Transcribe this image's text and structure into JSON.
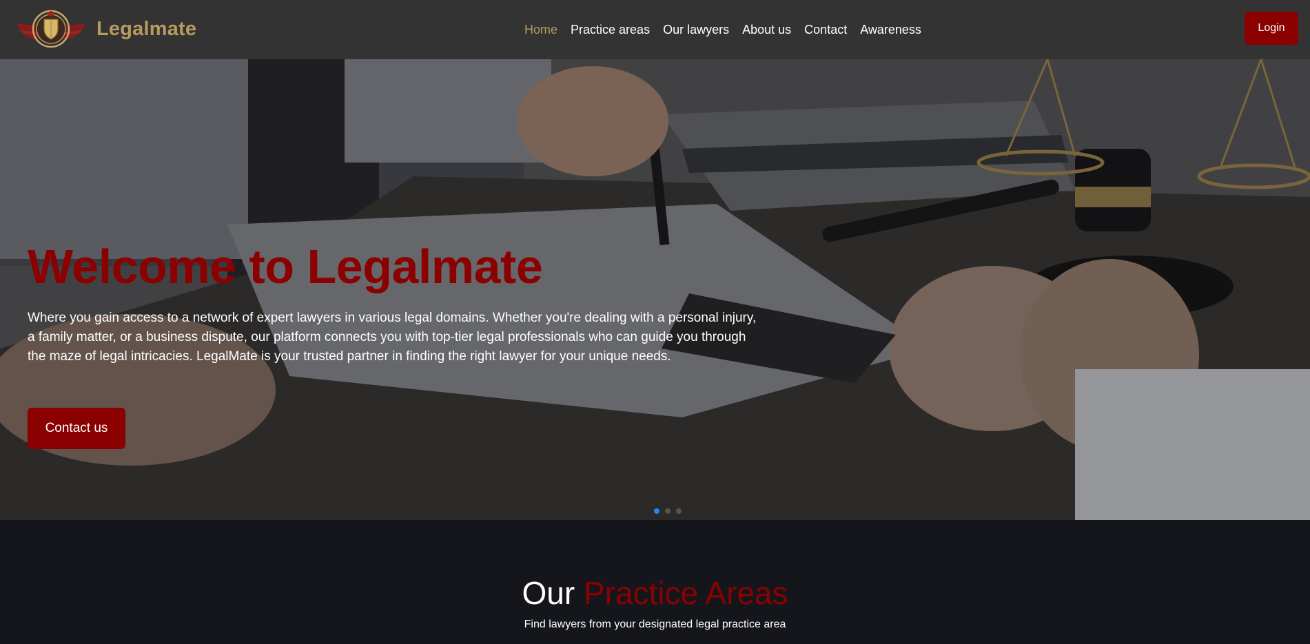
{
  "brand": {
    "name": "Legalmate",
    "logo_icon": "eagle-shield-logo"
  },
  "nav": {
    "items": [
      {
        "label": "Home",
        "active": true
      },
      {
        "label": "Practice areas",
        "active": false
      },
      {
        "label": "Our lawyers",
        "active": false
      },
      {
        "label": "About us",
        "active": false
      },
      {
        "label": "Contact",
        "active": false
      },
      {
        "label": "Awareness",
        "active": false
      }
    ],
    "login_label": "Login"
  },
  "hero": {
    "title": "Welcome to Legalmate",
    "text": "Where you gain access to a network of expert lawyers in various legal domains. Whether you're dealing with a personal injury, a family matter, or a business dispute, our platform connects you with top-tier legal professionals who can guide you through the maze of legal intricacies. LegalMate is your trusted partner in finding the right lawyer for your unique needs.",
    "cta_label": "Contact us",
    "carousel": {
      "slides": 3,
      "active_index": 0
    }
  },
  "practice": {
    "title_part1": "Our",
    "title_part2": "Practice Areas",
    "subtitle": "Find lawyers from your designated legal practice area"
  },
  "colors": {
    "navbar_bg": "#333333",
    "brand_gold": "#b99a5e",
    "accent_red": "#8b0000",
    "page_bg": "#15161b",
    "indicator_active": "#1e88ff"
  }
}
